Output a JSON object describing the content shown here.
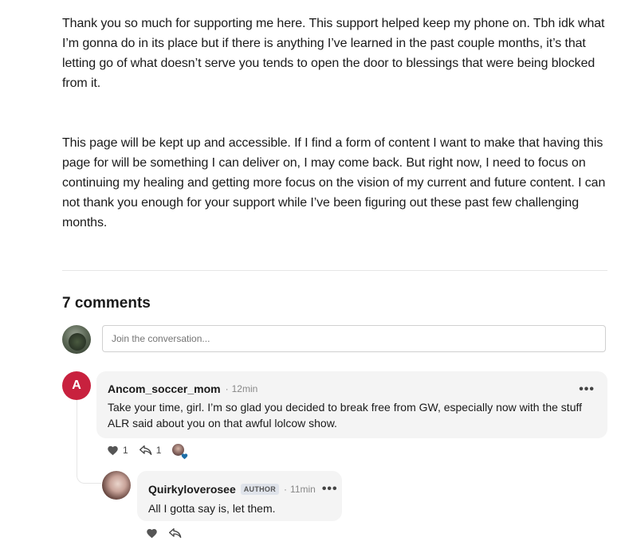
{
  "post": {
    "paragraphs": [
      "Thank you so much for supporting me here. This support helped keep my phone on. Tbh idk what I’m gonna do in its place but if there is anything I’ve learned in the past couple months, it’s that letting go of what doesn’t serve you tends to open the door to blessings that were being blocked from it.",
      "This page will be kept up and accessible. If I find a form of content I want to make that having this page for will be something I can deliver on, I may come back. But right now, I need to focus on continuing my healing and getting more focus on the vision of my current and future content. I can not thank you enough for your support while I’ve been figuring out these past few challenging months."
    ]
  },
  "comments": {
    "title": "7 comments",
    "composer_placeholder": "Join the conversation...",
    "items": [
      {
        "avatar_letter": "A",
        "avatar_color": "#c8213e",
        "author": "Ancom_soccer_mom",
        "separator": "·",
        "time": "12min",
        "more": "•••",
        "text": "Take your time, girl. I’m so glad you decided to break free from GW, especially now with the stuff ALR said about you on that awful lolcow show.",
        "like_count": "1",
        "reply_count": "1"
      },
      {
        "author": "Quirkyloverosee",
        "badge": "AUTHOR",
        "separator": "·",
        "time": "11min",
        "more": "•••",
        "text": "All I gotta say is, let them."
      }
    ]
  },
  "icons": {
    "like": "heart-icon",
    "reply": "reply-arrow-icon",
    "more": "more-dots-icon"
  },
  "colors": {
    "heart_fill": "#555555",
    "reaction_heart": "#1e6fa8",
    "bubble_bg": "#f4f4f4"
  }
}
